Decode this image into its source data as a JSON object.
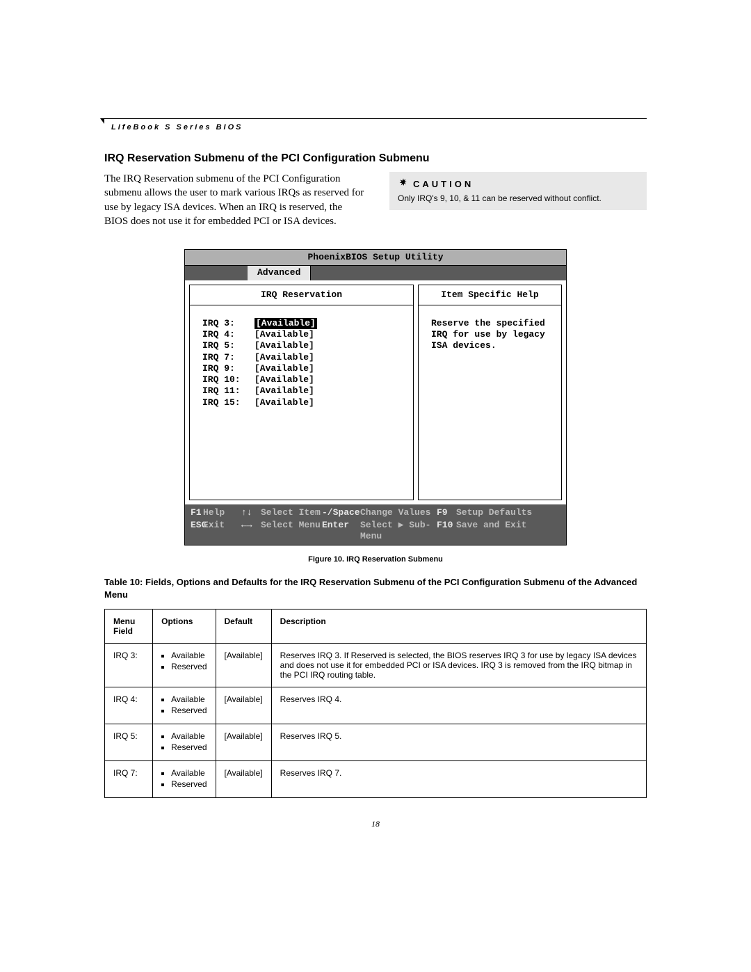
{
  "header": {
    "series": "LifeBook S Series BIOS"
  },
  "section": {
    "title": "IRQ Reservation Submenu of the PCI Configuration Submenu",
    "body": "The IRQ Reservation submenu of the PCI Configuration submenu allows the user to mark various IRQs as reserved for use by legacy ISA devices. When an IRQ is reserved, the BIOS does not use it for embedded PCI or ISA devices."
  },
  "caution": {
    "label": "CAUTION",
    "text": "Only IRQ's 9, 10, & 11 can be reserved without conflict."
  },
  "bios": {
    "title": "PhoenixBIOS Setup Utility",
    "tab": "Advanced",
    "pane_left_title": "IRQ Reservation",
    "pane_right_title": "Item Specific Help",
    "help_text": "Reserve the specified IRQ for use by legacy ISA devices.",
    "items": [
      {
        "label": "IRQ 3:",
        "value": "[Available]",
        "selected": true
      },
      {
        "label": "IRQ 4:",
        "value": "[Available]"
      },
      {
        "label": "IRQ 5:",
        "value": "[Available]"
      },
      {
        "label": "IRQ 7:",
        "value": "[Available]"
      },
      {
        "label": "IRQ 9:",
        "value": "[Available]"
      },
      {
        "label": "IRQ 10:",
        "value": "[Available]"
      },
      {
        "label": "IRQ 11:",
        "value": "[Available]"
      },
      {
        "label": "IRQ 15:",
        "value": "[Available]"
      }
    ],
    "footer": [
      {
        "k": "F1",
        "a": "Help",
        "k2": "↑↓",
        "a2": "Select Item",
        "k3": "-/Space",
        "a3": "Change Values",
        "k4": "F9",
        "a4": "Setup Defaults"
      },
      {
        "k": "ESC",
        "a": "Exit",
        "k2": "←→",
        "a2": "Select Menu",
        "k3": "Enter",
        "a3": "Select ▶ Sub-Menu",
        "k4": "F10",
        "a4": "Save and Exit"
      }
    ]
  },
  "figure_caption": "Figure 10.   IRQ Reservation Submenu",
  "table_title": "Table 10: Fields, Options and Defaults for the IRQ Reservation Submenu of the PCI Configuration Submenu of the Advanced Menu",
  "table": {
    "headers": [
      "Menu Field",
      "Options",
      "Default",
      "Description"
    ],
    "options": [
      "Available",
      "Reserved"
    ],
    "rows": [
      {
        "field": "IRQ 3:",
        "default": "[Available]",
        "desc": "Reserves IRQ 3. If Reserved is selected, the BIOS reserves IRQ 3 for use by legacy ISA devices and does not use it for embedded PCI or ISA devices. IRQ 3 is removed from the IRQ bitmap in the PCI IRQ routing table."
      },
      {
        "field": "IRQ 4:",
        "default": "[Available]",
        "desc": "Reserves IRQ 4."
      },
      {
        "field": "IRQ 5:",
        "default": "[Available]",
        "desc": "Reserves IRQ 5."
      },
      {
        "field": "IRQ 7:",
        "default": "[Available]",
        "desc": "Reserves IRQ 7."
      }
    ]
  },
  "page_number": "18"
}
